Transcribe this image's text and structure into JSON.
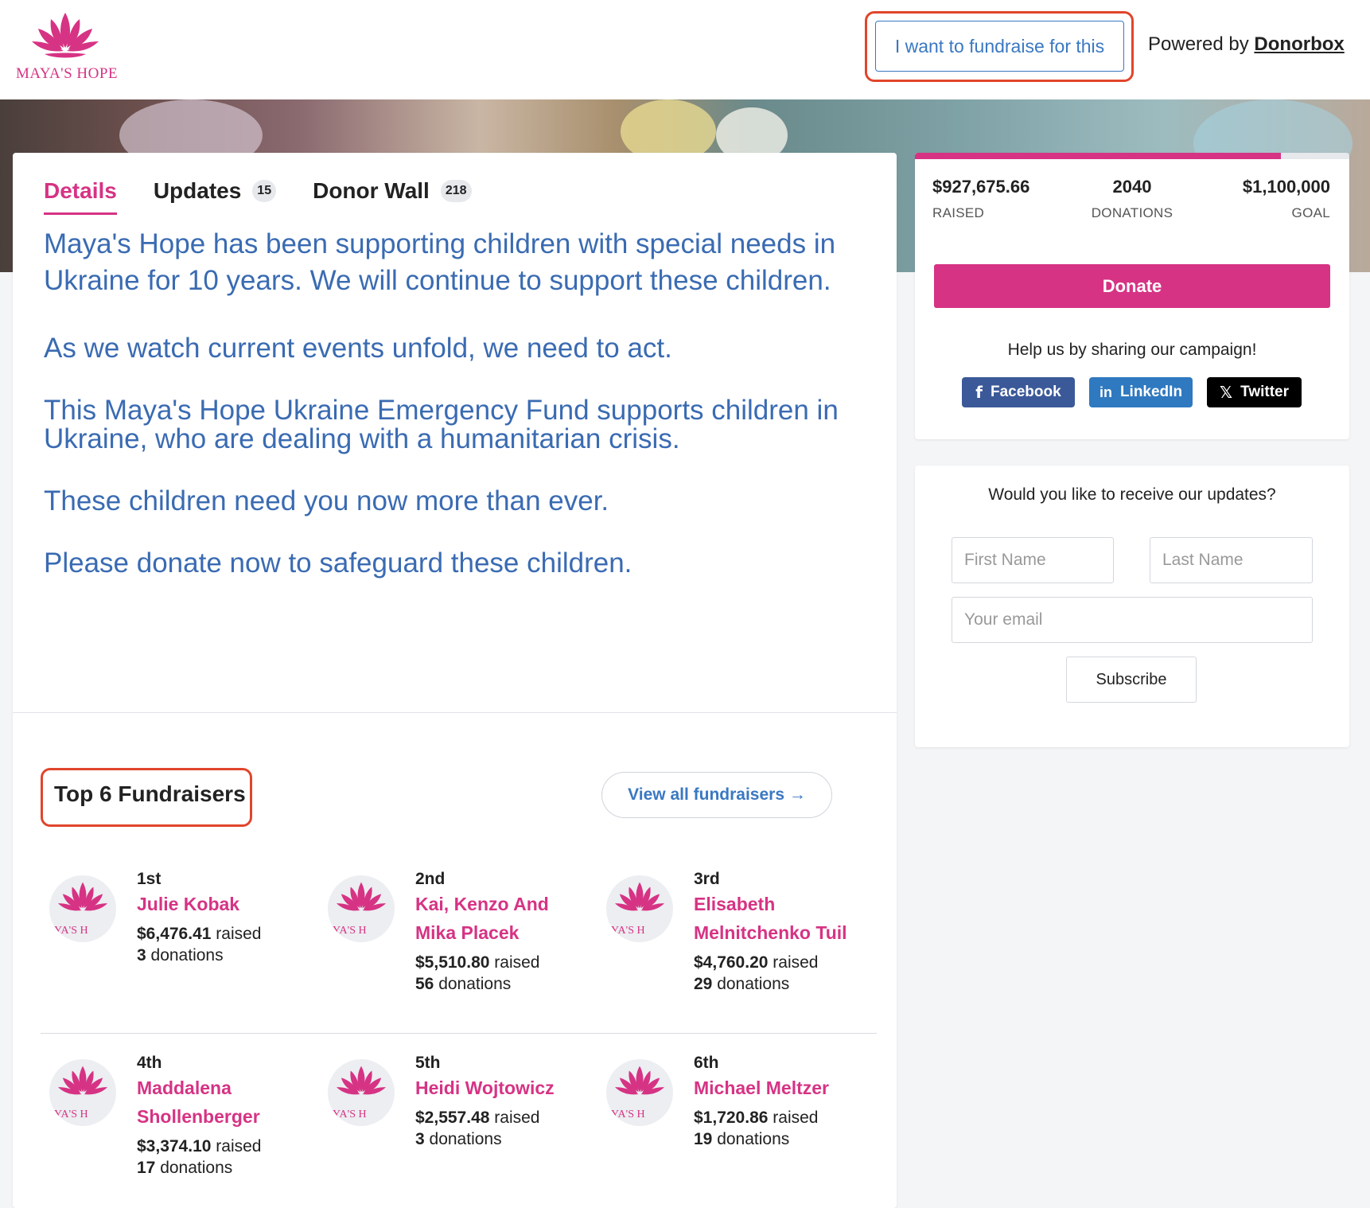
{
  "header": {
    "logo_text": "MAYA'S HOPE",
    "fundraise_label": "I want to fundraise for this",
    "powered_prefix": "Powered by",
    "powered_brand": "Donorbox"
  },
  "tabs": [
    {
      "label": "Details",
      "badge": ""
    },
    {
      "label": "Updates",
      "badge": "15"
    },
    {
      "label": "Donor Wall",
      "badge": "218"
    }
  ],
  "description": [
    "Maya's Hope has been supporting children with special needs in",
    "Ukraine for 10 years. We will continue to support these children.",
    "As we watch current events unfold, we need to act.",
    "This Maya's Hope Ukraine Emergency Fund supports children in",
    "Ukraine, who are dealing with a humanitarian crisis.",
    "These children need you now more than ever.",
    "Please donate now to safeguard these children."
  ],
  "fundraisers_section": {
    "title": "Top 6 Fundraisers",
    "view_all": "View all fundraisers →",
    "avatar_text": "YA'S H",
    "items": [
      {
        "rank": "1st",
        "name_lines": [
          "Julie Kobak"
        ],
        "amount": "$6,476.41",
        "raised": " raised",
        "donations": "3",
        "donations_label": " donations"
      },
      {
        "rank": "2nd",
        "name_lines": [
          "Kai, Kenzo And",
          "Mika Placek"
        ],
        "amount": "$5,510.80",
        "raised": " raised",
        "donations": "56",
        "donations_label": " donations"
      },
      {
        "rank": "3rd",
        "name_lines": [
          "Elisabeth",
          "Melnitchenko Tuil"
        ],
        "amount": "$4,760.20",
        "raised": " raised",
        "donations": "29",
        "donations_label": " donations"
      },
      {
        "rank": "4th",
        "name_lines": [
          "Maddalena",
          "Shollenberger"
        ],
        "amount": "$3,374.10",
        "raised": " raised",
        "donations": "17",
        "donations_label": " donations"
      },
      {
        "rank": "5th",
        "name_lines": [
          "Heidi Wojtowicz"
        ],
        "amount": "$2,557.48",
        "raised": " raised",
        "donations": "3",
        "donations_label": " donations"
      },
      {
        "rank": "6th",
        "name_lines": [
          "Michael Meltzer"
        ],
        "amount": "$1,720.86",
        "raised": " raised",
        "donations": "19",
        "donations_label": " donations"
      }
    ]
  },
  "stats": {
    "progress_fraction": 0.8433,
    "raised_value": "$927,675.66",
    "raised_label": "RAISED",
    "donations_value": "2040",
    "donations_label": "DONATIONS",
    "goal_value": "$1,100,000",
    "goal_label": "GOAL",
    "donate_label": "Donate",
    "share_text": "Help us by sharing our campaign!",
    "share": [
      {
        "label": "Facebook",
        "icon": "facebook-icon",
        "color": "#3b5998"
      },
      {
        "label": "LinkedIn",
        "icon": "linkedin-icon",
        "color": "#2f79c0"
      },
      {
        "label": "Twitter",
        "icon": "x-icon",
        "color": "#000000"
      }
    ]
  },
  "subscribe": {
    "title": "Would you like to receive our updates?",
    "first_name_placeholder": "First Name",
    "last_name_placeholder": "Last Name",
    "email_placeholder": "Your email",
    "button_label": "Subscribe"
  },
  "colors": {
    "accent": "#d63384",
    "link": "#3a78c2",
    "description_text": "#3a6bb2",
    "highlight_outline": "#e0452b"
  }
}
